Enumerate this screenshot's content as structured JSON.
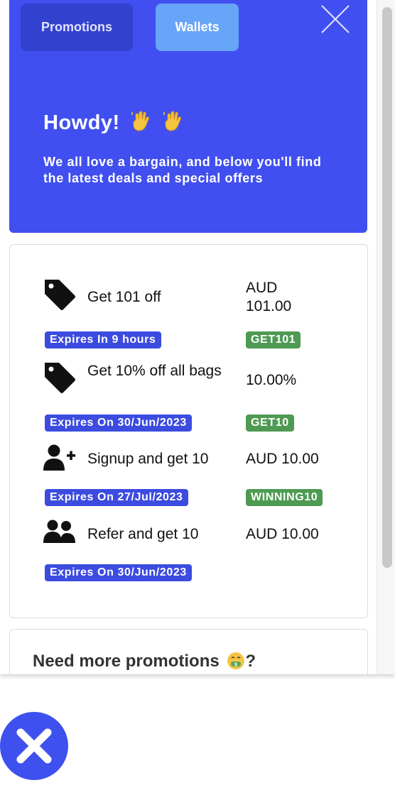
{
  "tabs": {
    "promotions": "Promotions",
    "wallets": "Wallets"
  },
  "hero": {
    "greeting": "Howdy!",
    "subtitle": "We all love a bargain, and below you'll find the latest deals and special offers"
  },
  "promotions": [
    {
      "title": "Get 101 off",
      "value": "AUD 101.00",
      "expiry": "Expires In 9 hours",
      "code": "GET101",
      "icon": "tag-icon"
    },
    {
      "title": "Get 10% off all bags",
      "value": "10.00%",
      "expiry": "Expires On 30/Jun/2023",
      "code": "GET10",
      "icon": "tag-icon"
    },
    {
      "title": "Signup and get 10",
      "value": "AUD 10.00",
      "expiry": "Expires On 27/Jul/2023",
      "code": "WINNING10",
      "icon": "user-plus-icon"
    },
    {
      "title": "Refer and get 10",
      "value": "AUD 10.00",
      "expiry": "Expires On 30/Jun/2023",
      "icon": "users-icon"
    }
  ],
  "more": {
    "heading_start": "Need more promotions",
    "heading_end": "?"
  },
  "colors": {
    "hero": "#414ff0",
    "badge_blue": "#3c4be0",
    "badge_green": "#4e9a52",
    "fab": "#3e51ee"
  }
}
